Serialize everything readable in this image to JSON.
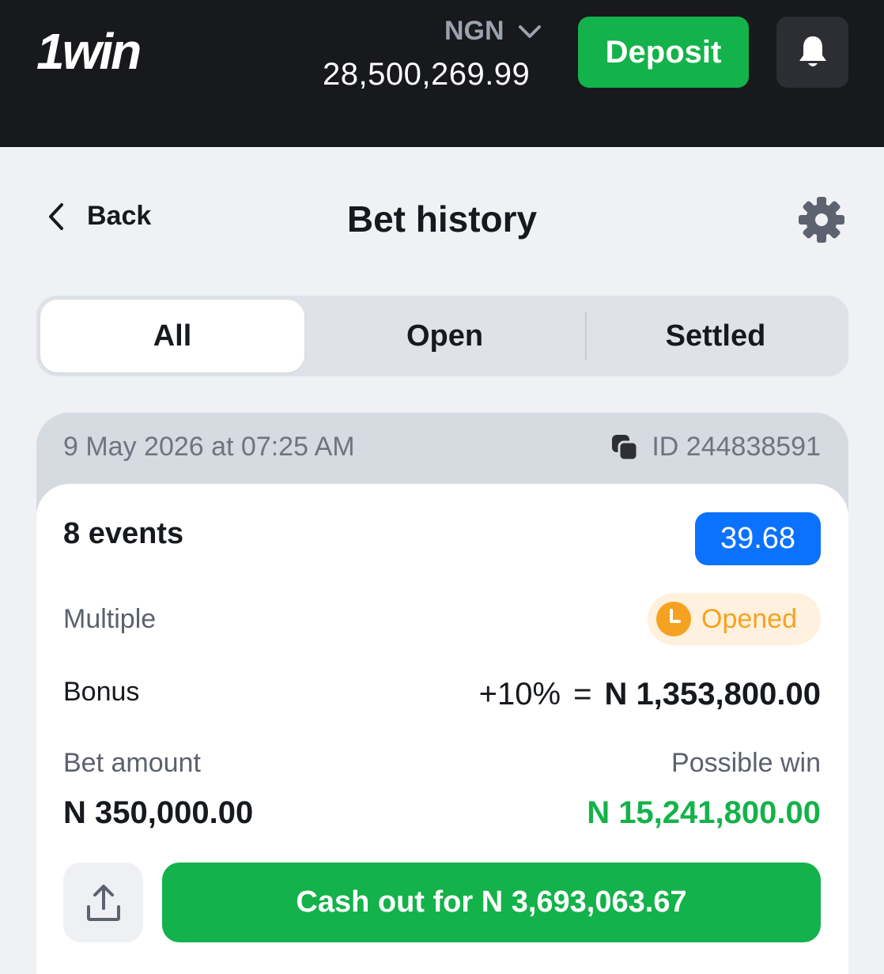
{
  "header": {
    "logo": "1win",
    "currency": "NGN",
    "balance": "28,500,269.99",
    "deposit_label": "Deposit"
  },
  "nav": {
    "back_label": "Back",
    "title": "Bet history"
  },
  "tabs": [
    {
      "label": "All",
      "active": true
    },
    {
      "label": "Open",
      "active": false
    },
    {
      "label": "Settled",
      "active": false
    }
  ],
  "bet": {
    "date": "9 May 2026 at 07:25 AM",
    "id": "ID 244838591",
    "events": "8 events",
    "odds": "39.68",
    "type": "Multiple",
    "status": "Opened",
    "bonus_label": "Bonus",
    "bonus_percent": "+10%",
    "bonus_eq": "=",
    "bonus_amount": "N 1,353,800.00",
    "amount_label": "Bet amount",
    "amount": "N 350,000.00",
    "win_label": "Possible win",
    "win": "N 15,241,800.00",
    "cashout_label": "Cash out for N 3,693,063.67"
  },
  "colors": {
    "topbar": "#18191c",
    "accent_green": "#14b24a",
    "odds_blue": "#0b72ff",
    "status_orange": "#f5a221"
  }
}
